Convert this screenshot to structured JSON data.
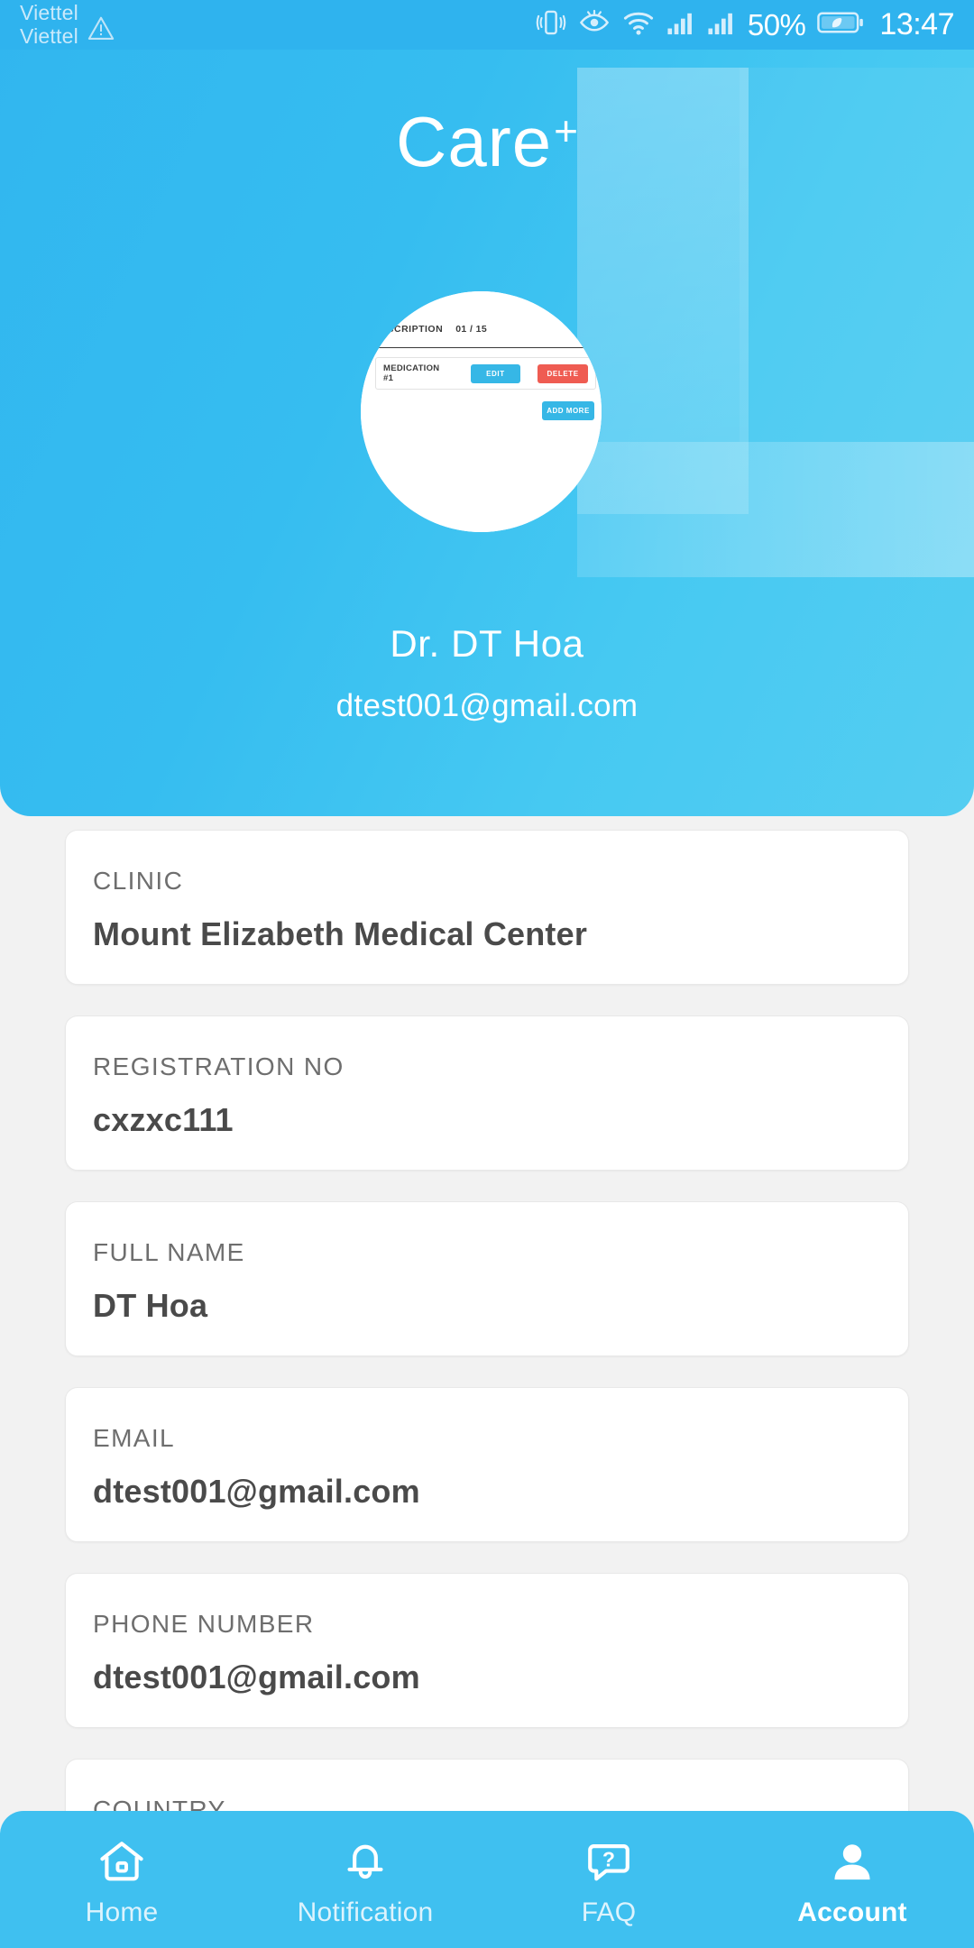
{
  "status_bar": {
    "carrier_line_1": "Viettel",
    "carrier_line_2": "Viettel",
    "battery_percent": "50%",
    "time": "13:47",
    "icons": [
      "warning-triangle-icon",
      "vibrate-icon",
      "eye-comfort-icon",
      "wifi-icon",
      "signal-sim1-icon",
      "signal-sim2-icon",
      "battery-saver-icon"
    ]
  },
  "header": {
    "logo_text": "Care",
    "logo_plus": "+",
    "accent_color": "#31b6ef",
    "profile_name": "Dr. DT Hoa",
    "profile_email": "dtest001@gmail.com"
  },
  "avatar": {
    "prescription_title": "ESCRIPTION",
    "prescription_count": "01 / 15",
    "medication_label": "MEDICATION #1",
    "edit_label": "EDIT",
    "delete_label": "DELETE",
    "add_more_label": "ADD MORE",
    "edit_color": "#36b7e6",
    "delete_color": "#ef5c52"
  },
  "info_cards": [
    {
      "label": "CLINIC",
      "value": "Mount Elizabeth Medical Center"
    },
    {
      "label": "REGISTRATION NO",
      "value": "cxzxc111"
    },
    {
      "label": "FULL NAME",
      "value": "DT Hoa"
    },
    {
      "label": "EMAIL",
      "value": "dtest001@gmail.com"
    },
    {
      "label": "PHONE NUMBER",
      "value": "dtest001@gmail.com"
    },
    {
      "label": "COUNTRY",
      "value": ""
    }
  ],
  "bottom_nav": {
    "items": [
      {
        "label": "Home",
        "icon": "home-icon",
        "active": false
      },
      {
        "label": "Notification",
        "icon": "bell-icon",
        "active": false
      },
      {
        "label": "FAQ",
        "icon": "question-chat-icon",
        "active": false
      },
      {
        "label": "Account",
        "icon": "person-icon",
        "active": true
      }
    ]
  }
}
